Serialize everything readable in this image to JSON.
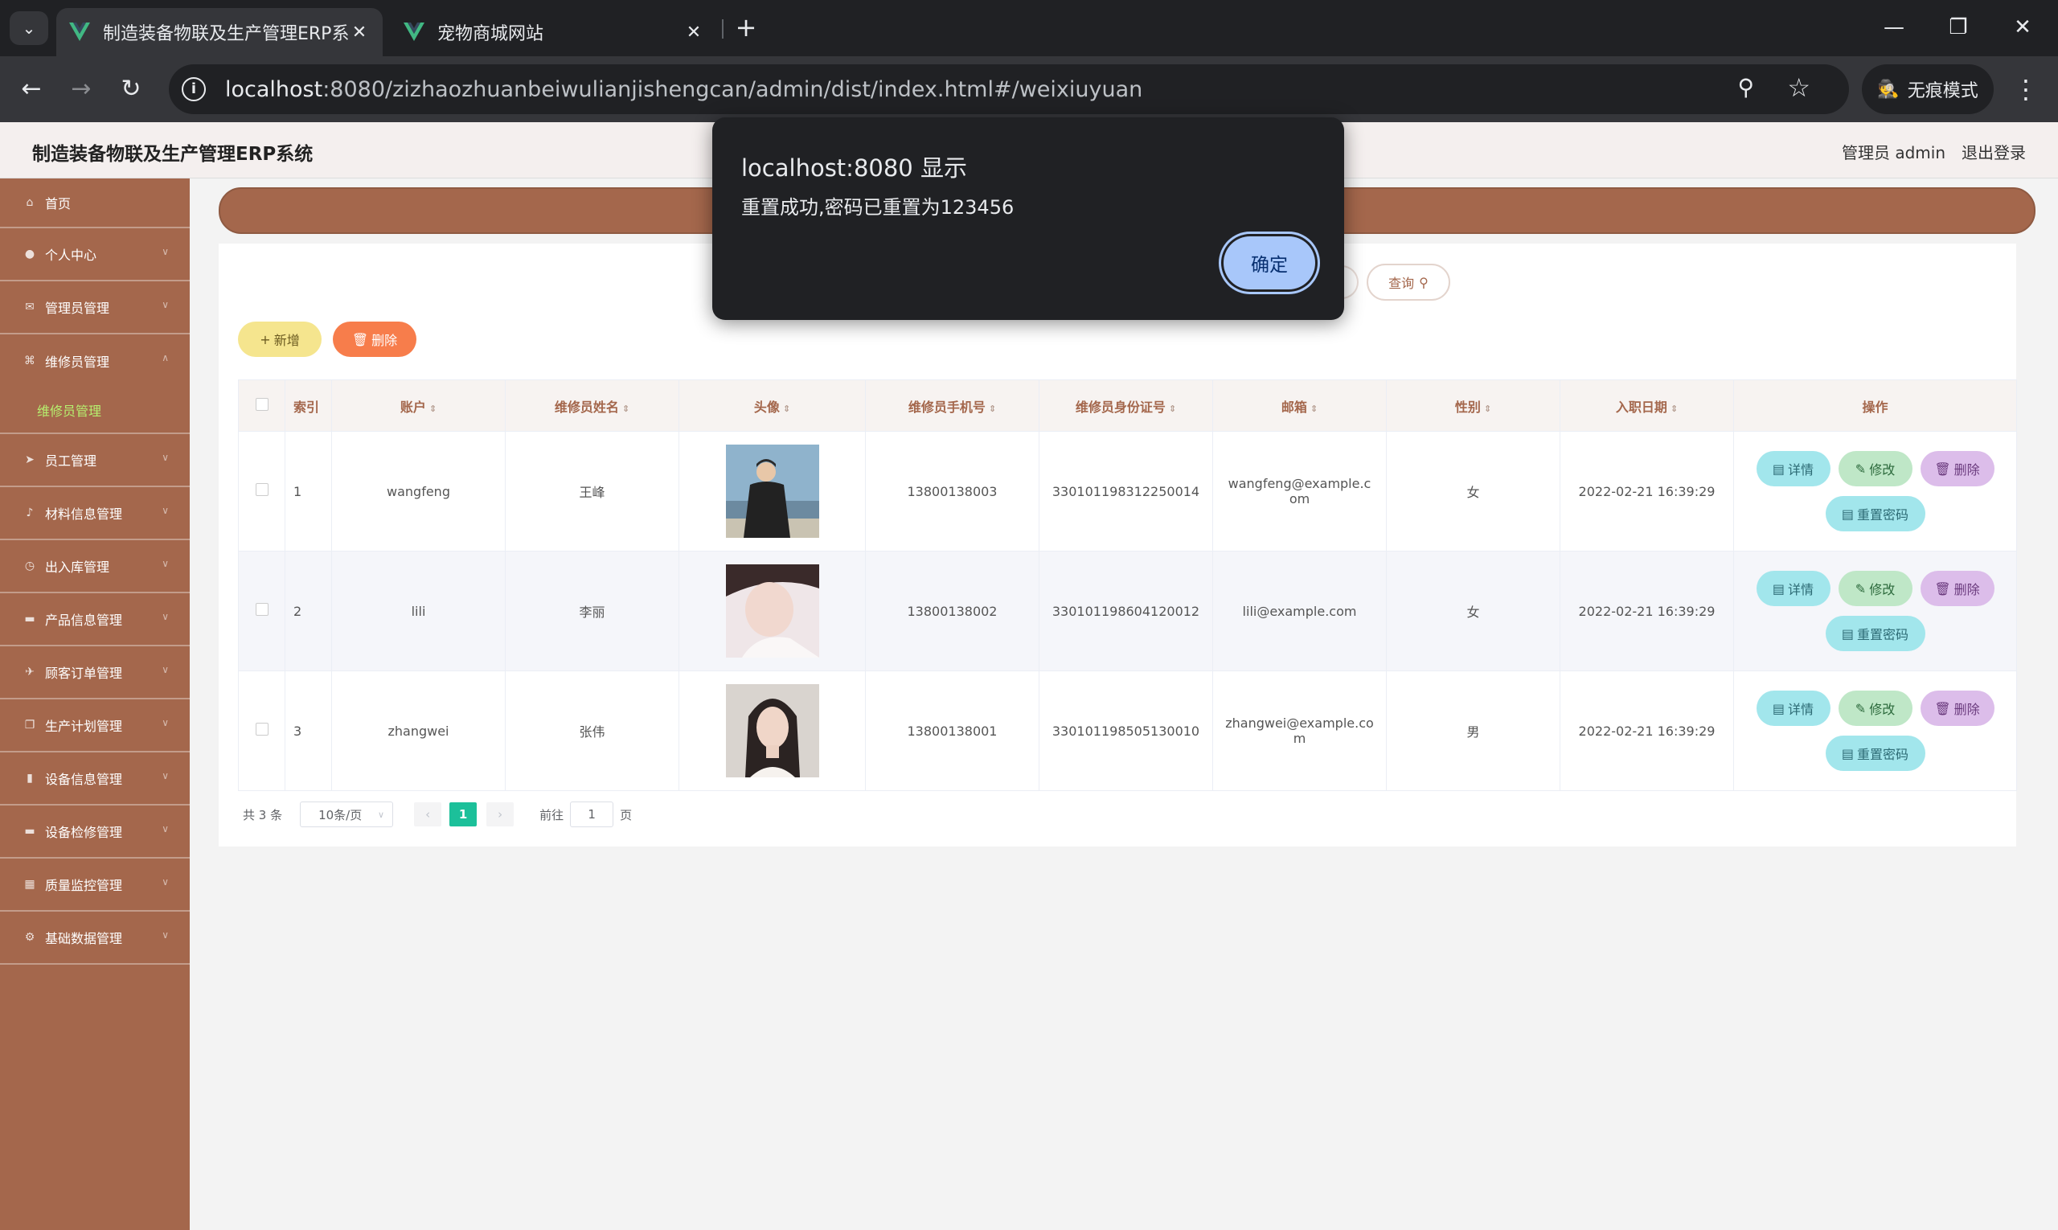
{
  "browser": {
    "tabs": [
      {
        "title": "制造装备物联及生产管理ERP系",
        "active": true
      },
      {
        "title": "宠物商城网站",
        "active": false
      }
    ],
    "url_host": "localhost",
    "url_rest": ":8080/zizhaozhuanbeiwulianjishengcan/admin/dist/index.html#/weixiuyuan",
    "incognito_label": "无痕模式"
  },
  "app": {
    "title": "制造装备物联及生产管理ERP系统",
    "user": "管理员 admin",
    "logout": "退出登录"
  },
  "sidebar": {
    "items": [
      {
        "label": "首页",
        "icon": "home-icon"
      },
      {
        "label": "个人中心",
        "icon": "user-icon"
      },
      {
        "label": "管理员管理",
        "icon": "mail-icon"
      },
      {
        "label": "维修员管理",
        "icon": "lock-icon",
        "expanded": true
      },
      {
        "label": "员工管理",
        "icon": "send-icon"
      },
      {
        "label": "材料信息管理",
        "icon": "microphone-icon"
      },
      {
        "label": "出入库管理",
        "icon": "clock-icon"
      },
      {
        "label": "产品信息管理",
        "icon": "chat-icon"
      },
      {
        "label": "顾客订单管理",
        "icon": "plane-icon"
      },
      {
        "label": "生产计划管理",
        "icon": "copy-icon"
      },
      {
        "label": "设备信息管理",
        "icon": "chart-icon"
      },
      {
        "label": "设备检修管理",
        "icon": "message-icon"
      },
      {
        "label": "质量监控管理",
        "icon": "grid-icon"
      },
      {
        "label": "基础数据管理",
        "icon": "cog-icon"
      }
    ],
    "subitem": "维修员管理"
  },
  "toolbar": {
    "search": "查询",
    "add": "新增",
    "delete": "删除"
  },
  "table": {
    "headers": [
      "索引",
      "账户",
      "维修员姓名",
      "头像",
      "维修员手机号",
      "维修员身份证号",
      "邮箱",
      "性别",
      "入职日期",
      "操作"
    ],
    "rows": [
      {
        "index": "1",
        "account": "wangfeng",
        "name": "王峰",
        "phone": "13800138003",
        "id_card": "330101198312250014",
        "email": "wangfeng@example.com",
        "gender": "女",
        "date": "2022-02-21 16:39:29"
      },
      {
        "index": "2",
        "account": "lili",
        "name": "李丽",
        "phone": "13800138002",
        "id_card": "330101198604120012",
        "email": "lili@example.com",
        "gender": "女",
        "date": "2022-02-21 16:39:29"
      },
      {
        "index": "3",
        "account": "zhangwei",
        "name": "张伟",
        "phone": "13800138001",
        "id_card": "330101198505130010",
        "email": "zhangwei@example.com",
        "gender": "男",
        "date": "2022-02-21 16:39:29"
      }
    ],
    "actions": {
      "detail": "详情",
      "edit": "修改",
      "delete": "删除",
      "reset": "重置密码"
    }
  },
  "pagination": {
    "total": "共 3 条",
    "page_size": "10条/页",
    "current_page": "1",
    "goto_prefix": "前往",
    "goto_value": "1",
    "goto_suffix": "页"
  },
  "alert": {
    "title": "localhost:8080 显示",
    "message": "重置成功,密码已重置为123456",
    "ok": "确定"
  },
  "colors": {
    "accent": "#a4674c",
    "submenu_active": "#b6f06f",
    "page_active": "#1cc09a",
    "dialog_button": "#a8c7fa"
  }
}
